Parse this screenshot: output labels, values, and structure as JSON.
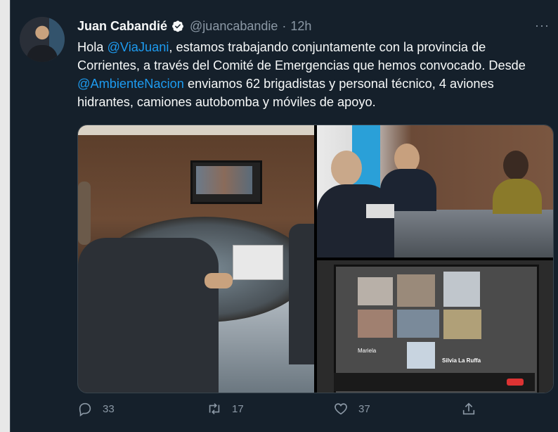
{
  "tweet": {
    "author_name": "Juan Cabandié",
    "handle": "@juancabandie",
    "separator": "·",
    "time": "12h",
    "more_label": "···",
    "text": {
      "p1": "Hola ",
      "m1": "@ViaJuani",
      "p2": ", estamos trabajando conjuntamente con la provincia de Corrientes, a través del Comité de Emergencias que hemos convocado. Desde ",
      "m2": "@AmbienteNacion",
      "p3": " enviamos 62 brigadistas y personal técnico, 4 aviones hidrantes, camiones autobomba y móviles de apoyo."
    },
    "media_labels": {
      "nametag_1": "Mariela",
      "nametag_2": "Silvia La Ruffa"
    }
  },
  "actions": {
    "reply_count": "33",
    "retweet_count": "17",
    "like_count": "37"
  },
  "colors": {
    "background": "#15202b",
    "text": "#f7f9f9",
    "muted": "#8b98a5",
    "link": "#1d9bf0"
  },
  "icons": [
    "verified-badge-icon",
    "more-icon",
    "reply-icon",
    "retweet-icon",
    "like-icon",
    "share-icon"
  ]
}
